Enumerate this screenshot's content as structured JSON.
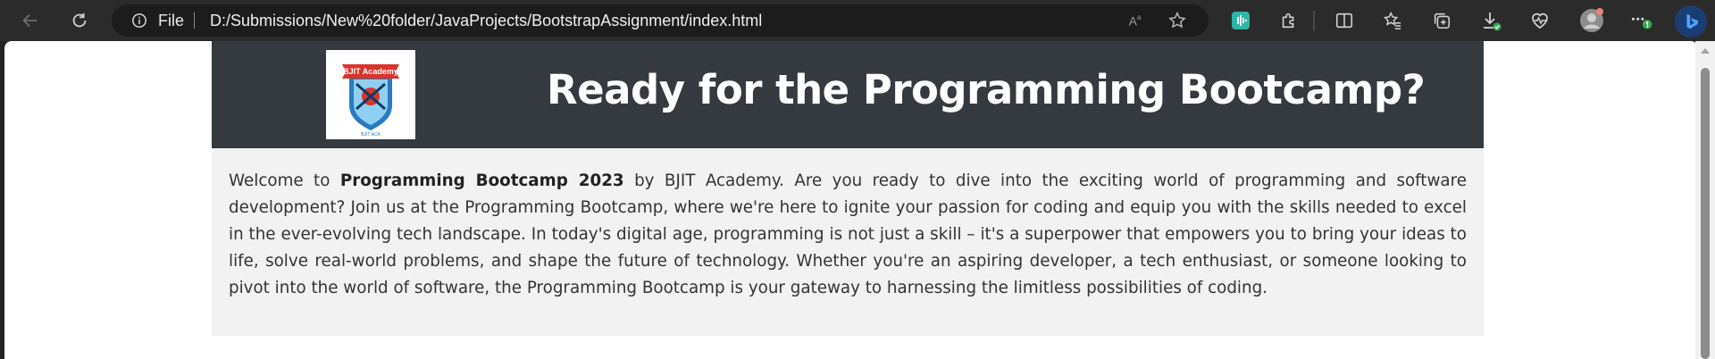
{
  "browser": {
    "scheme_label": "File",
    "url": "D:/Submissions/New%20folder/JavaProjects/BootstrapAssignment/index.html",
    "icons": [
      "back-icon",
      "refresh-icon",
      "info-icon",
      "read-aloud-icon",
      "favorite-star-icon",
      "extension-teal-icon",
      "puzzle-icon",
      "split-screen-icon",
      "favorites-icon",
      "collections-icon",
      "downloads-icon",
      "health-icon",
      "profile-avatar",
      "more-icon",
      "bing-icon"
    ]
  },
  "page": {
    "header": {
      "title": "Ready for the Programming Bootcamp?",
      "logo_text": "BJIT Academy",
      "logo_small_text": "BJIT ACA"
    },
    "intro": {
      "lead": "Welcome to ",
      "bold": "Programming Bootcamp 2023",
      "rest": " by BJIT Academy. Are you ready to dive into the exciting world of programming and software development? Join us at the Programming Bootcamp, where we're here to ignite your passion for coding and equip you with the skills needed to excel in the ever-evolving tech landscape. In today's digital age, programming is not just a skill – it's a superpower that empowers you to bring your ideas to life, solve real-world problems, and shape the future of technology. Whether you're an aspiring developer, a tech enthusiast, or someone looking to pivot into the world of software, the Programming Bootcamp is your gateway to harnessing the limitless possibilities of coding."
    }
  },
  "colors": {
    "header_bg": "#343a40",
    "body_bg": "#f2f2f2",
    "chrome_bg": "#2b2b2b"
  }
}
